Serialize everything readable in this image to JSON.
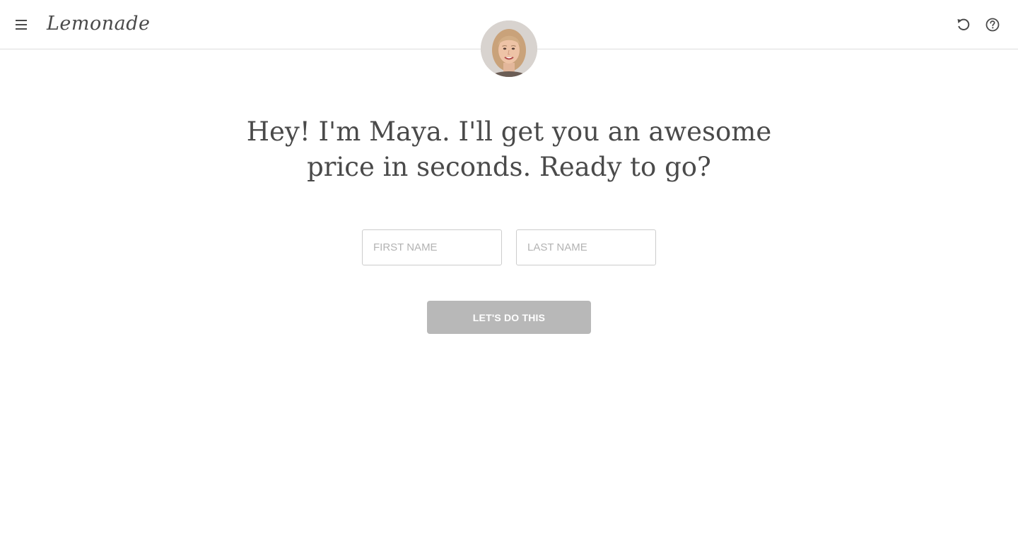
{
  "header": {
    "logo_text": "Lemonade",
    "menu_icon": "hamburger-icon",
    "restart_icon": "restart-icon",
    "help_icon": "help-icon"
  },
  "assistant": {
    "avatar_icon": "maya-avatar",
    "headline_line1": "Hey! I'm Maya. I'll get you an awesome",
    "headline_line2": "price in seconds. Ready to go?"
  },
  "form": {
    "first_name": {
      "value": "",
      "placeholder": "FIRST NAME"
    },
    "last_name": {
      "value": "",
      "placeholder": "LAST NAME"
    },
    "submit_label": "LET'S DO THIS"
  },
  "colors": {
    "text": "#4a4a4a",
    "border": "#cccccc",
    "button_disabled": "#b8b8b8",
    "divider": "#dddddd"
  }
}
